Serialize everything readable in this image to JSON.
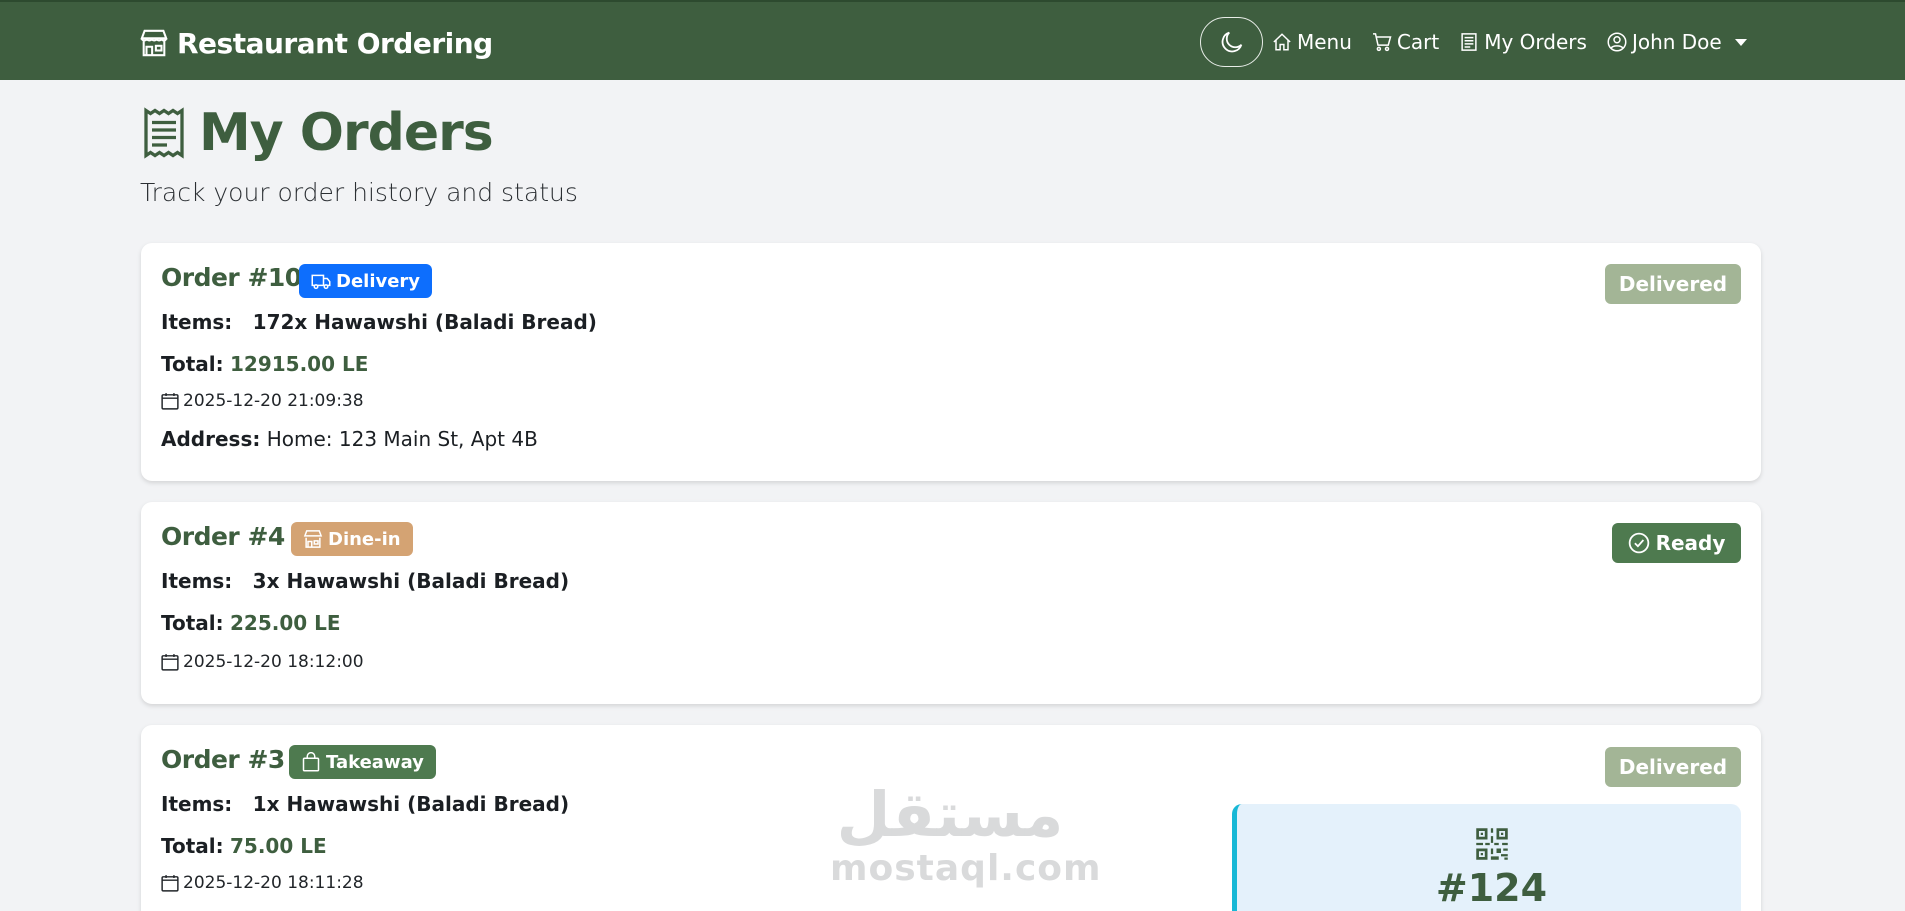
{
  "navbar": {
    "brand": "Restaurant Ordering",
    "links": {
      "menu": "Menu",
      "cart": "Cart",
      "orders": "My Orders",
      "user": "John Doe"
    },
    "color": "#3e5e3f"
  },
  "page": {
    "title": "My Orders",
    "subtitle": "Track your order history and status"
  },
  "labels": {
    "items": "Items:",
    "total": "Total:",
    "address": "Address:"
  },
  "orders": [
    {
      "number": "Order #10",
      "type": "Delivery",
      "type_icon": "truck-icon",
      "type_color": "#0d6efd",
      "status": "Delivered",
      "status_color": "#a3b596",
      "items": "172x Hawawshi (Baladi Bread)",
      "total": "12915.00 LE",
      "date": "2025-12-20 21:09:38",
      "address": "Home: 123 Main St, Apt 4B"
    },
    {
      "number": "Order #4",
      "type": "Dine-in",
      "type_icon": "shop-icon",
      "type_color": "#d4a373",
      "status": "Ready",
      "status_icon": "check-circle-icon",
      "status_color": "#4e7a4f",
      "items": "3x Hawawshi (Baladi Bread)",
      "total": "225.00 LE",
      "date": "2025-12-20 18:12:00"
    },
    {
      "number": "Order #3",
      "type": "Takeaway",
      "type_icon": "bag-icon",
      "type_color": "#4e7a4f",
      "status": "Delivered",
      "status_color": "#a3b596",
      "items": "1x Hawawshi (Baladi Bread)",
      "total": "75.00 LE",
      "date": "2025-12-20 18:11:28",
      "pickup_number": "#124"
    }
  ],
  "watermark": {
    "arabic": "مستقل",
    "latin": "mostaql.com"
  }
}
